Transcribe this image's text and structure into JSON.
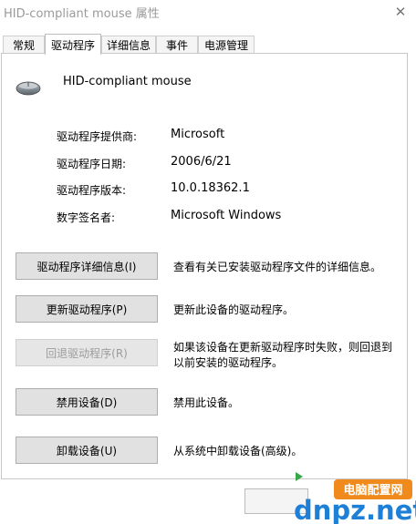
{
  "window": {
    "title": "HID-compliant mouse 属性",
    "close_glyph": "✕"
  },
  "tabs": [
    {
      "label": "常规"
    },
    {
      "label": "驱动程序"
    },
    {
      "label": "详细信息"
    },
    {
      "label": "事件"
    },
    {
      "label": "电源管理"
    }
  ],
  "device": {
    "name": "HID-compliant mouse",
    "icon": "mouse-icon"
  },
  "info": [
    {
      "label": "驱动程序提供商:",
      "value": "Microsoft"
    },
    {
      "label": "驱动程序日期:",
      "value": "2006/6/21"
    },
    {
      "label": "驱动程序版本:",
      "value": "10.0.18362.1"
    },
    {
      "label": "数字签名者:",
      "value": "Microsoft Windows"
    }
  ],
  "actions": [
    {
      "button": "驱动程序详细信息(I)",
      "desc": "查看有关已安装驱动程序文件的详细信息。",
      "enabled": true
    },
    {
      "button": "更新驱动程序(P)",
      "desc": "更新此设备的驱动程序。",
      "enabled": true
    },
    {
      "button": "回退驱动程序(R)",
      "desc": "如果该设备在更新驱动程序时失败，则回退到以前安装的驱动程序。",
      "enabled": false
    },
    {
      "button": "禁用设备(D)",
      "desc": "禁用此设备。",
      "enabled": true
    },
    {
      "button": "卸载设备(U)",
      "desc": "从系统中卸载设备(高级)。",
      "enabled": true
    }
  ],
  "watermark": {
    "brand": "dnpz.net",
    "tagline": "电脑配置网"
  },
  "colors": {
    "watermark_orange": "#f08a1c",
    "watermark_blue": "#1e7fd6"
  }
}
